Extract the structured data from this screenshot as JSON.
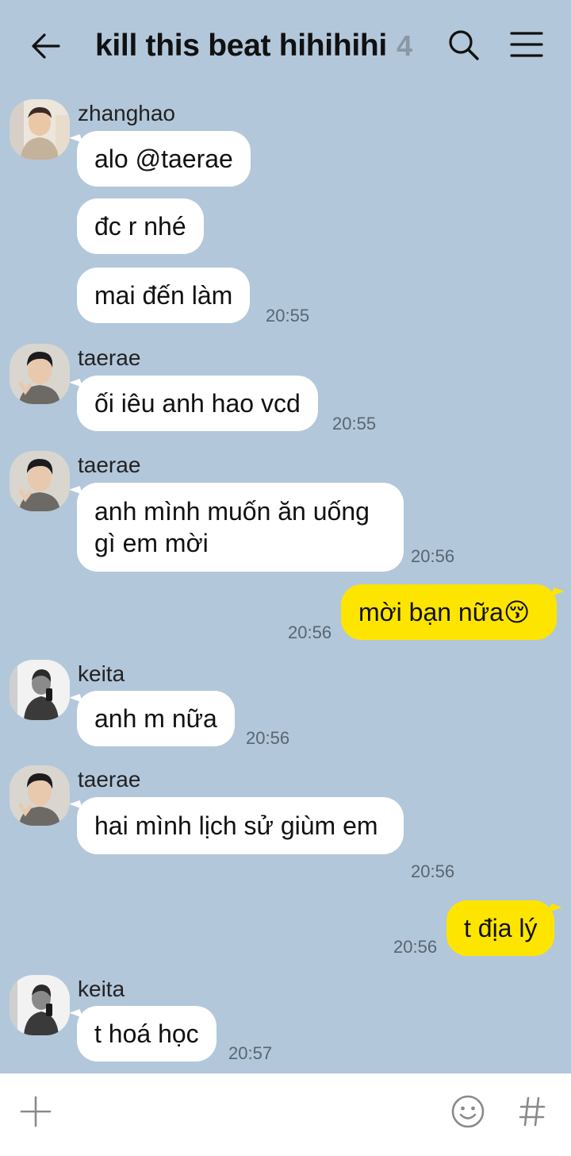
{
  "header": {
    "title": "kill this beat hihihihi",
    "member_count": "4",
    "icons": [
      "back-arrow-icon",
      "search-icon",
      "menu-icon"
    ]
  },
  "messages": [
    {
      "sender": "zhanghao",
      "lines": [
        "alo @taerae",
        "đc r nhé",
        "mai đến làm"
      ],
      "time": "20:55"
    },
    {
      "sender": "taerae",
      "lines": [
        "ối iêu anh hao vcd"
      ],
      "time": "20:55"
    },
    {
      "sender": "taerae",
      "lines": [
        "anh mình muốn ăn uống gì em mời"
      ],
      "time": "20:56"
    },
    {
      "sender": "me",
      "lines": [
        "mời bạn nữa😚"
      ],
      "time": "20:56"
    },
    {
      "sender": "keita",
      "lines": [
        "anh m nữa"
      ],
      "time": "20:56"
    },
    {
      "sender": "taerae",
      "lines": [
        "hai mình lịch sử giùm em"
      ],
      "time": "20:56"
    },
    {
      "sender": "me",
      "lines": [
        "t địa lý"
      ],
      "time": "20:56"
    },
    {
      "sender": "keita",
      "lines": [
        "t hoá học"
      ],
      "time": "20:57"
    }
  ],
  "bottom_bar": {
    "icons": [
      "plus-icon",
      "emoji-icon",
      "hashtag-icon"
    ]
  },
  "colors": {
    "background": "#b2c7da",
    "my_bubble": "#fee500",
    "other_bubble": "#ffffff"
  }
}
